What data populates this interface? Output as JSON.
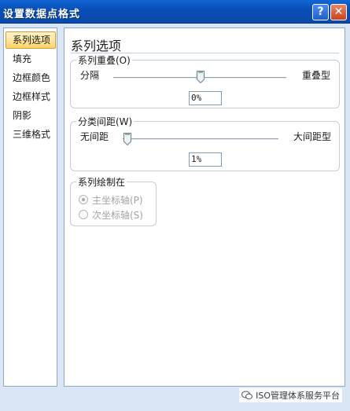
{
  "window": {
    "title": "设置数据点格式",
    "help_glyph": "?",
    "close_glyph": "✕"
  },
  "sidebar": {
    "items": [
      {
        "label": "系列选项",
        "active": true
      },
      {
        "label": "填充"
      },
      {
        "label": "边框颜色"
      },
      {
        "label": "边框样式"
      },
      {
        "label": "阴影"
      },
      {
        "label": "三维格式"
      }
    ]
  },
  "panel": {
    "title": "系列选项",
    "overlap": {
      "legend": "系列重叠(O)",
      "left_label": "分隔",
      "right_label": "重叠型",
      "value": "0%",
      "slider_fraction": 0.5
    },
    "gap": {
      "legend": "分类间距(W)",
      "left_label": "无间距",
      "right_label": "大间距型",
      "value": "1%",
      "slider_fraction": 0.0
    },
    "plot_on": {
      "legend": "系列绘制在",
      "options": [
        "主坐标轴(P)",
        "次坐标轴(S)"
      ],
      "selected": 0
    }
  },
  "watermark": {
    "text": "ISO管理体系服务平台"
  },
  "colors": {
    "title_bar": "#0a4fb8",
    "dialog_bg": "#dbe6f4",
    "active_tab": "#ffd56a"
  }
}
